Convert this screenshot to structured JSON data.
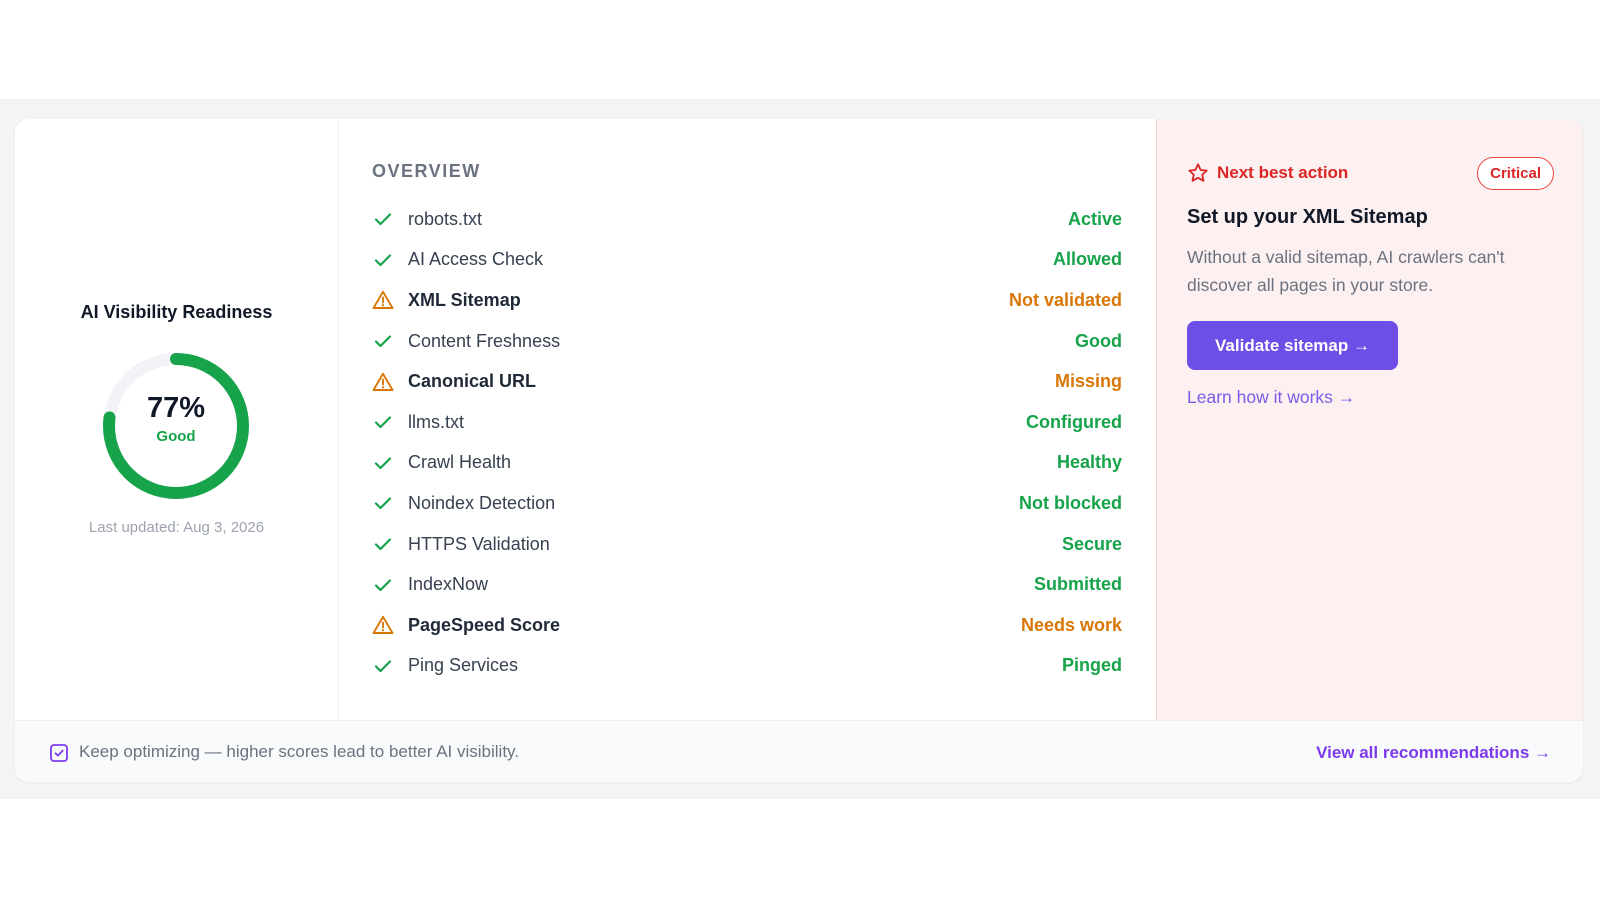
{
  "score": {
    "title": "AI Visibility Readiness",
    "percent": 77,
    "percent_label": "77%",
    "status": "Good",
    "last_updated": "Last updated: Aug 3, 2026",
    "ring_color": "#16a34a",
    "track_color": "#f1f3f6"
  },
  "overview": {
    "heading": "OVERVIEW",
    "items": [
      {
        "label": "robots.txt",
        "status": "Active",
        "state": "ok"
      },
      {
        "label": "AI Access Check",
        "status": "Allowed",
        "state": "ok"
      },
      {
        "label": "XML Sitemap",
        "status": "Not validated",
        "state": "warn"
      },
      {
        "label": "Content Freshness",
        "status": "Good",
        "state": "ok"
      },
      {
        "label": "Canonical URL",
        "status": "Missing",
        "state": "warn"
      },
      {
        "label": "llms.txt",
        "status": "Configured",
        "state": "ok"
      },
      {
        "label": "Crawl Health",
        "status": "Healthy",
        "state": "ok"
      },
      {
        "label": "Noindex Detection",
        "status": "Not blocked",
        "state": "ok"
      },
      {
        "label": "HTTPS Validation",
        "status": "Secure",
        "state": "ok"
      },
      {
        "label": "IndexNow",
        "status": "Submitted",
        "state": "ok"
      },
      {
        "label": "PageSpeed Score",
        "status": "Needs work",
        "state": "warn"
      },
      {
        "label": "Ping Services",
        "status": "Pinged",
        "state": "ok"
      }
    ]
  },
  "action": {
    "label": "Next best action",
    "badge": "Critical",
    "title": "Set up your XML Sitemap",
    "description": "Without a valid sitemap, AI crawlers can't discover all pages in your store.",
    "button_label": "Validate sitemap →",
    "link_label": "Learn how it works →"
  },
  "footer": {
    "text": "Keep optimizing — higher scores lead to better AI visibility.",
    "link_label": "View all recommendations →"
  },
  "colors": {
    "ok": "#16a34a",
    "warn": "#d97706",
    "critical": "#dc2626",
    "accent": "#6d4ee6"
  }
}
